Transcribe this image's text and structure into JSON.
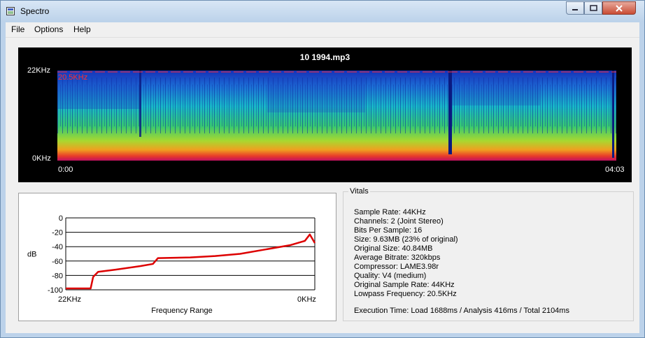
{
  "window": {
    "title": "Spectro"
  },
  "menu": {
    "file": "File",
    "options": "Options",
    "help": "Help"
  },
  "spectrogram": {
    "file_name": "10 1994.mp3",
    "y_top_label": "22KHz",
    "y_bottom_label": "0KHz",
    "lowpass_label": "20.5KHz",
    "time_start": "0:00",
    "time_end": "04:03"
  },
  "chart_data": {
    "type": "line",
    "ylabel": "dB",
    "xlabel": "Frequency Range",
    "x_tick_left": "22KHz",
    "x_tick_right": "0KHz",
    "yticks": [
      "0",
      "-20",
      "-40",
      "-60",
      "-80",
      "-100"
    ],
    "ylim": [
      -100,
      0
    ],
    "grid": true,
    "x_direction": "22KHz to 0KHz",
    "series": [
      {
        "color": "#dd0000",
        "points": [
          [
            0,
            -98
          ],
          [
            0.1,
            -98
          ],
          [
            0.11,
            -82
          ],
          [
            0.13,
            -75
          ],
          [
            0.2,
            -72
          ],
          [
            0.3,
            -67
          ],
          [
            0.35,
            -64
          ],
          [
            0.37,
            -56
          ],
          [
            0.5,
            -55
          ],
          [
            0.6,
            -53
          ],
          [
            0.7,
            -50
          ],
          [
            0.8,
            -44
          ],
          [
            0.9,
            -38
          ],
          [
            0.96,
            -32
          ],
          [
            0.98,
            -23
          ],
          [
            1.0,
            -35
          ]
        ]
      }
    ]
  },
  "vitals": {
    "legend": "Vitals",
    "lines": [
      "Sample Rate: 44KHz",
      "Channels: 2 (Joint Stereo)",
      "Bits Per Sample: 16",
      "Size: 9.63MB (23% of original)",
      "Original Size: 40.84MB",
      "Average Bitrate: 320kbps",
      "Compressor: LAME3.98r",
      "Quality: V4 (medium)",
      "Original Sample Rate: 44KHz",
      "Lowpass Frequency: 20.5KHz"
    ],
    "execution_time": "Execution Time: Load 1688ms / Analysis 416ms / Total 2104ms"
  }
}
